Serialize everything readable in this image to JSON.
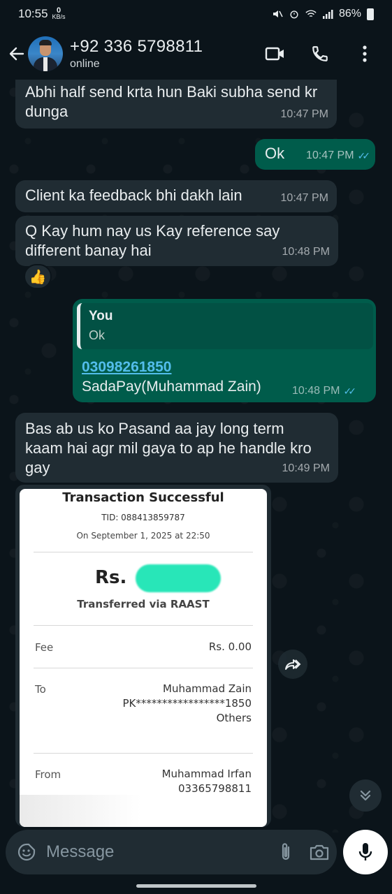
{
  "status_bar": {
    "time": "10:55",
    "speed_value": "0",
    "speed_unit": "KB/s",
    "battery": "86%"
  },
  "header": {
    "contact_name": "+92 336 5798811",
    "contact_status": "online"
  },
  "messages": [
    {
      "type": "incoming",
      "text": "Abhi half send krta hun Baki subha send kr dunga",
      "time": "10:47 PM"
    },
    {
      "type": "outgoing",
      "text": "Ok",
      "time": "10:47 PM",
      "read": true
    },
    {
      "type": "incoming",
      "text": "Client ka feedback bhi dakh lain",
      "time": "10:47 PM"
    },
    {
      "type": "incoming",
      "text": "Q Kay hum nay us Kay reference say different banay hai",
      "time": "10:48 PM",
      "reaction": "👍"
    },
    {
      "type": "outgoing",
      "quote_author": "You",
      "quote_text": "Ok",
      "link": "03098261850",
      "text": "SadaPay(Muhammad Zain)",
      "time": "10:48 PM",
      "read": true
    },
    {
      "type": "incoming",
      "text": "Bas ab us ko Pasand aa jay long term kaam hai agr mil gaya to ap he handle kro gay",
      "time": "10:49 PM"
    }
  ],
  "receipt": {
    "title": "Transaction Successful",
    "tid": "TID: 088413859787",
    "date": "On September 1, 2025 at 22:50",
    "amount_prefix": "Rs.",
    "transfer_method": "Transferred via RAAST",
    "fee_label": "Fee",
    "fee_value": "Rs. 0.00",
    "to_label": "To",
    "to_name": "Muhammad Zain",
    "to_account": "PK*****************1850",
    "to_bank": "Others",
    "from_label": "From",
    "from_name": "Muhammad Irfan",
    "from_number": "03365798811"
  },
  "input": {
    "placeholder": "Message"
  },
  "colors": {
    "background": "#0b141a",
    "incoming_bubble": "#202c33",
    "outgoing_bubble": "#005c4b",
    "read_ticks": "#53bdeb"
  }
}
